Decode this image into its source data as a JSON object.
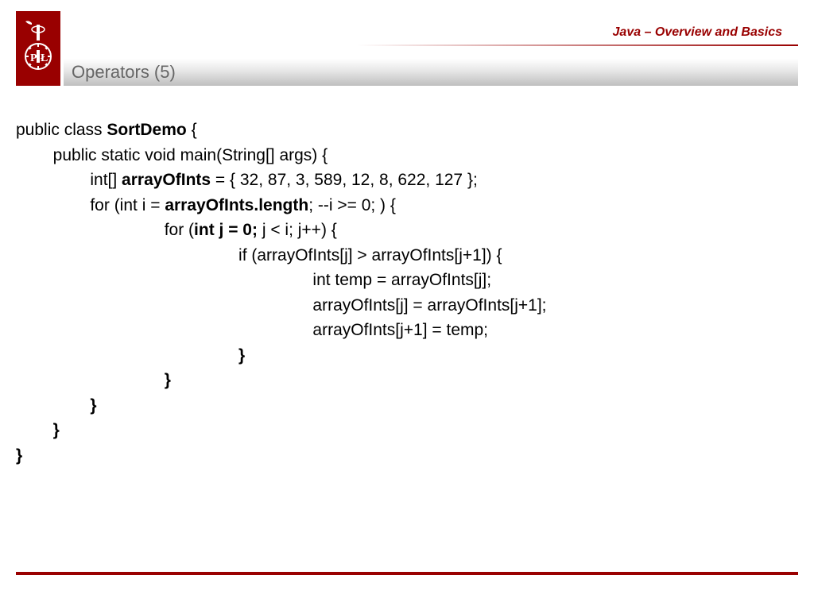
{
  "header": {
    "course_title": "Java – Overview and Basics",
    "slide_title": "Operators (5)"
  },
  "code": {
    "l1a": "public class ",
    "l1b": "SortDemo",
    "l1c": " {",
    "l2": "        public static void main(String[] args) {",
    "l3a": "                int[] ",
    "l3b": "arrayOfInts",
    "l3c": " = { 32, 87, 3, 589, 12, 8, 622, 127 };",
    "l4a": "                for (int i = ",
    "l4b": "arrayOfInts.length",
    "l4c": "; --i >= 0; ) {",
    "l5a": "                                for (",
    "l5b": "int j = 0;",
    "l5c": " j < i; j++) {",
    "l6": "                                                if (arrayOfInts[j] > arrayOfInts[j+1]) {",
    "l7": "                                                                int temp = arrayOfInts[j];",
    "l8": "                                                                arrayOfInts[j] = arrayOfInts[j+1];",
    "l9": "                                                                arrayOfInts[j+1] = temp;",
    "l10": "                                                }",
    "l11": "                                }",
    "l12": "                }",
    "l13": "        }",
    "l14": "}"
  }
}
